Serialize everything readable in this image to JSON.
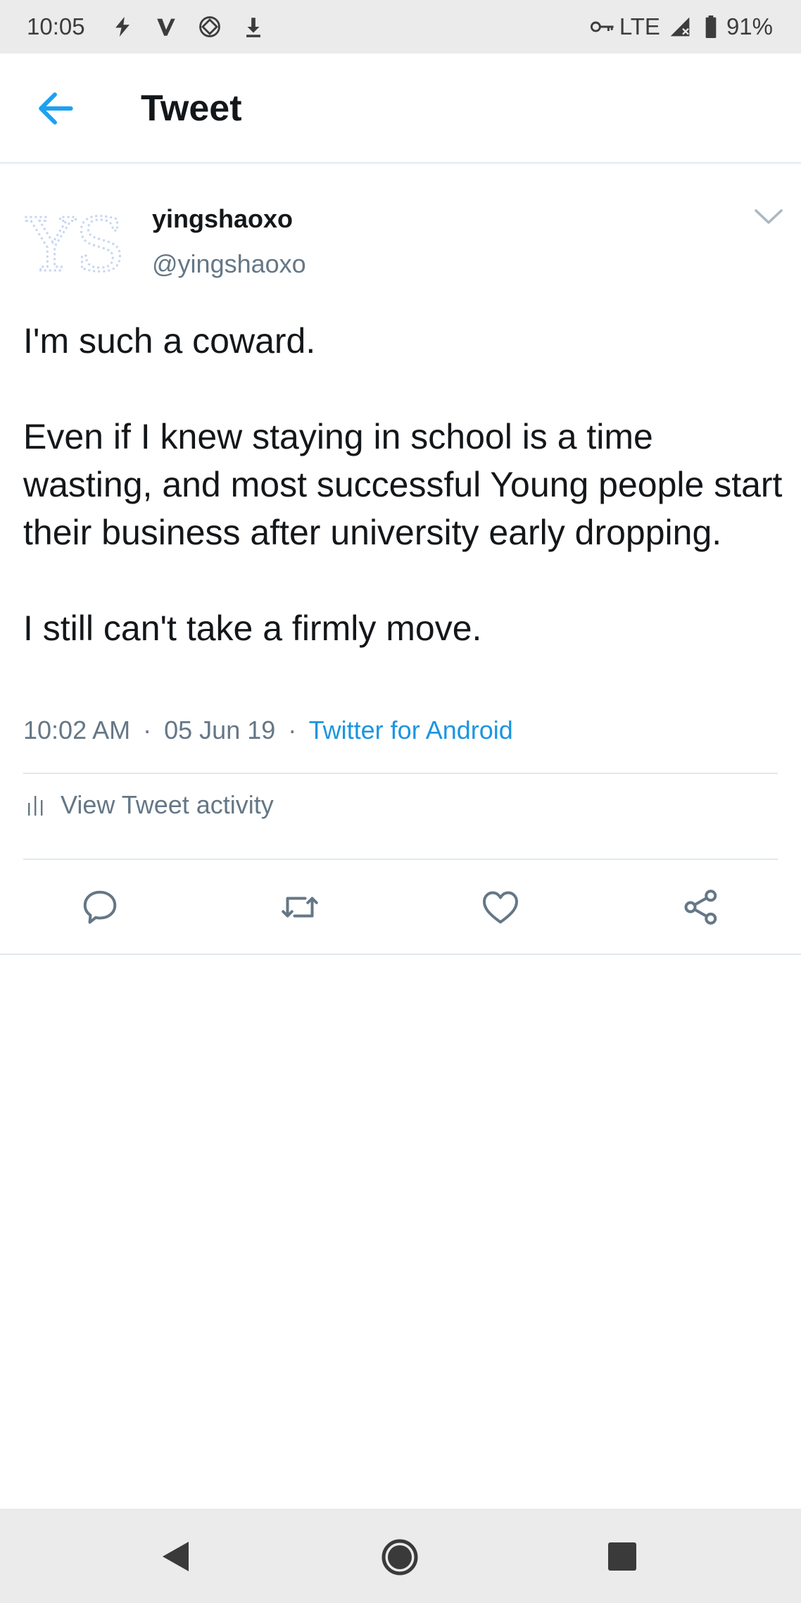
{
  "status_bar": {
    "time": "10:05",
    "network": "LTE",
    "battery": "91%",
    "left_icons": [
      "flash-icon",
      "vpn-v-icon",
      "screen-rotate-icon",
      "download-icon"
    ],
    "right_icons": [
      "vpn-key-icon",
      "signal-icon",
      "battery-icon"
    ]
  },
  "header": {
    "title": "Tweet",
    "back_icon": "arrow-left-icon",
    "accent_color": "#1da1f2"
  },
  "tweet": {
    "avatar_text": "YS",
    "display_name": "yingshaoxo",
    "handle": "@yingshaoxo",
    "paragraphs": [
      "I'm such a coward.",
      "Even if I knew staying in school is a time wasting, and most successful Young people start their business after university early dropping.",
      "I still can't take a firmly move."
    ],
    "time": "10:02 AM",
    "separator": "·",
    "date": "05 Jun 19",
    "source": "Twitter for Android",
    "activity_label": "View Tweet activity",
    "actions": [
      "reply-icon",
      "retweet-icon",
      "like-icon",
      "share-icon"
    ]
  },
  "nav_bar": {
    "buttons": [
      "back-triangle-icon",
      "home-circle-icon",
      "recents-square-icon"
    ]
  }
}
